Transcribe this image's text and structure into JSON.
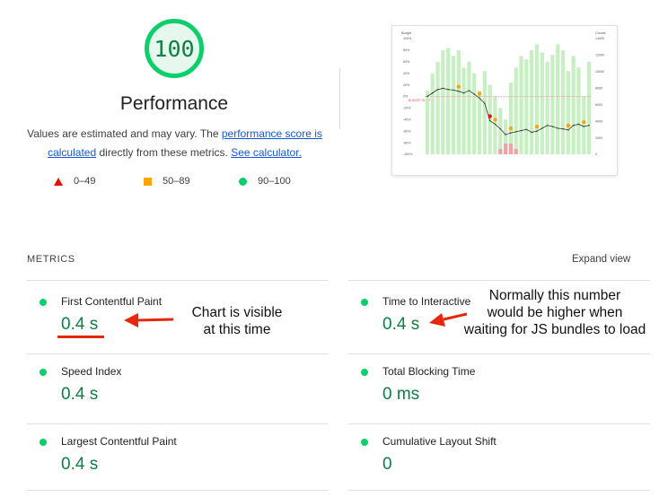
{
  "category": {
    "score": "100",
    "score_fraction": 1.0,
    "gauge_color": "#0cce6b",
    "title": "Performance",
    "description_prefix": "Values are estimated and may vary. The ",
    "score_link": "performance score is calculated",
    "description_middle": " directly from these metrics. ",
    "calculator_link": "See calculator."
  },
  "legend": [
    {
      "label": "0–49",
      "shape": "triangle",
      "color": "#eb0f00"
    },
    {
      "label": "50–89",
      "shape": "square",
      "color": "#ffa400"
    },
    {
      "label": "90–100",
      "shape": "circle",
      "color": "#0cce6b"
    }
  ],
  "metrics_section": {
    "title": "METRICS",
    "expand_label": "Expand view"
  },
  "metrics": [
    {
      "label": "First Contentful Paint",
      "value": "0.4 s"
    },
    {
      "label": "Time to Interactive",
      "value": "0.4 s"
    },
    {
      "label": "Speed Index",
      "value": "0.4 s"
    },
    {
      "label": "Total Blocking Time",
      "value": "0 ms"
    },
    {
      "label": "Largest Contentful Paint",
      "value": "0.4 s"
    },
    {
      "label": "Cumulative Layout Shift",
      "value": "0"
    }
  ],
  "annotations": {
    "fcp_note": [
      "Chart is visible",
      "at this time"
    ],
    "tti_note": [
      "Normally this number",
      "would be higher when",
      "waiting for JS bundles to load"
    ]
  },
  "screenshot_thumbnail": {
    "left_header": "Budget",
    "right_header": "Counts",
    "budget_label": "BUDGET SHIFT",
    "left_ticks": [
      "100%",
      "80%",
      "60%",
      "40%",
      "20%",
      "0%",
      "-20%",
      "-40%",
      "-60%",
      "-80%",
      "-100%"
    ],
    "right_ticks": [
      "14000",
      "12000",
      "10000",
      "8000",
      "6000",
      "4000",
      "2000",
      "0"
    ],
    "bars": [
      0.55,
      0.7,
      0.8,
      0.9,
      0.92,
      0.85,
      0.9,
      0.75,
      0.8,
      0.7,
      0.55,
      0.72,
      0.6,
      0.5,
      0.4,
      0.3,
      0.62,
      0.75,
      0.85,
      0.82,
      0.9,
      0.95,
      0.88,
      0.8,
      0.86,
      0.95,
      0.9,
      0.72,
      0.85,
      0.75,
      0.5,
      0.8
    ],
    "line": [
      0.0,
      0.06,
      0.12,
      0.14,
      0.12,
      0.11,
      0.09,
      0.06,
      0.1,
      0.04,
      -0.03,
      -0.12,
      -0.42,
      -0.48,
      -0.56,
      -0.66,
      -0.63,
      -0.61,
      -0.59,
      -0.57,
      -0.62,
      -0.6,
      -0.55,
      -0.5,
      -0.52,
      -0.55,
      -0.56,
      -0.58,
      -0.5,
      -0.48,
      -0.52,
      -0.5
    ],
    "markers": [
      {
        "i": 6,
        "color": "#ffa400"
      },
      {
        "i": 10,
        "color": "#ffa400"
      },
      {
        "i": 12,
        "color": "#eb0f00"
      },
      {
        "i": 13,
        "color": "#ffa400"
      },
      {
        "i": 16,
        "color": "#ffa400"
      },
      {
        "i": 21,
        "color": "#ffa400"
      },
      {
        "i": 27,
        "color": "#ffa400"
      },
      {
        "i": 30,
        "color": "#ffa400"
      }
    ],
    "red_bars": [
      14,
      15,
      16,
      17
    ]
  }
}
